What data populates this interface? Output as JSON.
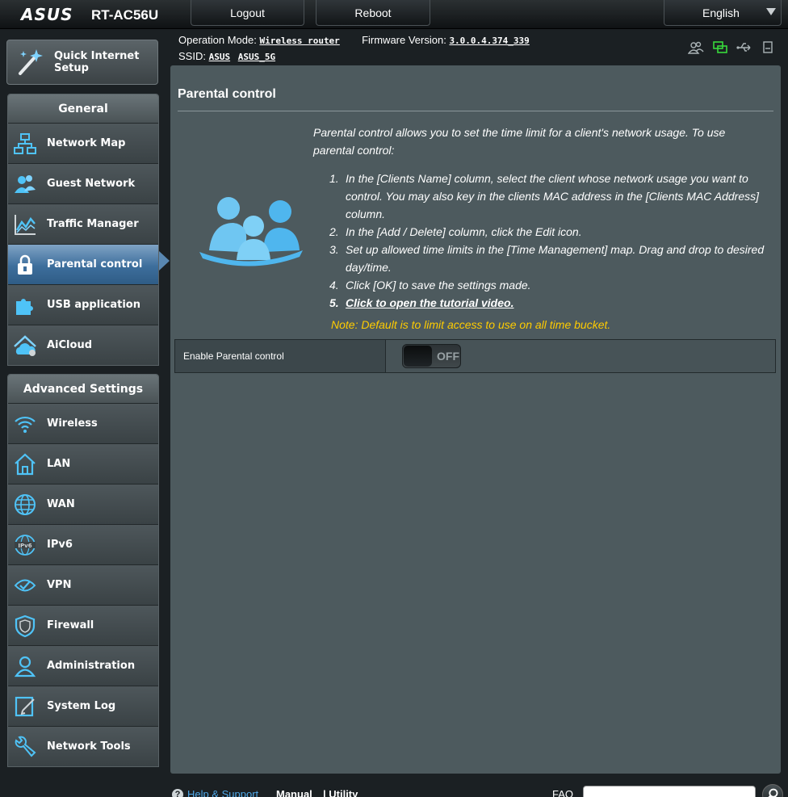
{
  "header": {
    "logo": "ASUS",
    "model": "RT-AC56U",
    "logout_label": "Logout",
    "reboot_label": "Reboot",
    "language": "English"
  },
  "info": {
    "op_mode_label": "Operation Mode:",
    "op_mode_value": "Wireless router",
    "firmware_label": "Firmware Version:",
    "firmware_value": "3.0.0.4.374_339",
    "ssid_label": "SSID:",
    "ssid_1": "ASUS",
    "ssid_2": "ASUS_5G"
  },
  "sidebar": {
    "qis_label_1": "Quick Internet",
    "qis_label_2": "Setup",
    "general_title": "General",
    "general_items": [
      {
        "label": "Network Map",
        "icon": "network-map-icon"
      },
      {
        "label": "Guest Network",
        "icon": "guest-network-icon"
      },
      {
        "label": "Traffic Manager",
        "icon": "traffic-manager-icon"
      },
      {
        "label": "Parental control",
        "icon": "parental-control-icon"
      },
      {
        "label": "USB application",
        "icon": "usb-application-icon"
      },
      {
        "label": "AiCloud",
        "icon": "aicloud-icon"
      }
    ],
    "advanced_title": "Advanced Settings",
    "advanced_items": [
      {
        "label": "Wireless",
        "icon": "wireless-icon"
      },
      {
        "label": "LAN",
        "icon": "lan-icon"
      },
      {
        "label": "WAN",
        "icon": "wan-icon"
      },
      {
        "label": "IPv6",
        "icon": "ipv6-icon"
      },
      {
        "label": "VPN",
        "icon": "vpn-icon"
      },
      {
        "label": "Firewall",
        "icon": "firewall-icon"
      },
      {
        "label": "Administration",
        "icon": "administration-icon"
      },
      {
        "label": "System Log",
        "icon": "system-log-icon"
      },
      {
        "label": "Network Tools",
        "icon": "network-tools-icon"
      }
    ]
  },
  "main": {
    "title": "Parental control",
    "description": "Parental control allows you to set the time limit for a client's network usage. To use parental control:",
    "steps": [
      "In the [Clients Name] column, select the client whose network usage you want to control. You may also key in the clients MAC address in the [Clients MAC Address] column.",
      "In the [Add / Delete] column, click the Edit icon.",
      "Set up allowed time limits in the [Time Management] map. Drag and drop to desired day/time.",
      "Click [OK] to save the settings made.",
      "Click to open the tutorial video."
    ],
    "note": "Note: Default is to limit access to use on all time bucket.",
    "enable_label": "Enable Parental control",
    "toggle_state": "OFF"
  },
  "footer": {
    "help_label": "Help & Support",
    "manual_label": "Manual",
    "utility_label": "Utility",
    "faq_label": "FAQ",
    "search_value": ""
  },
  "colors": {
    "panel": "#4d5a5e",
    "accent_blue": "#3d6e9c",
    "note_yellow": "#ffcc00",
    "icon_cyan": "#4fc3f7"
  }
}
